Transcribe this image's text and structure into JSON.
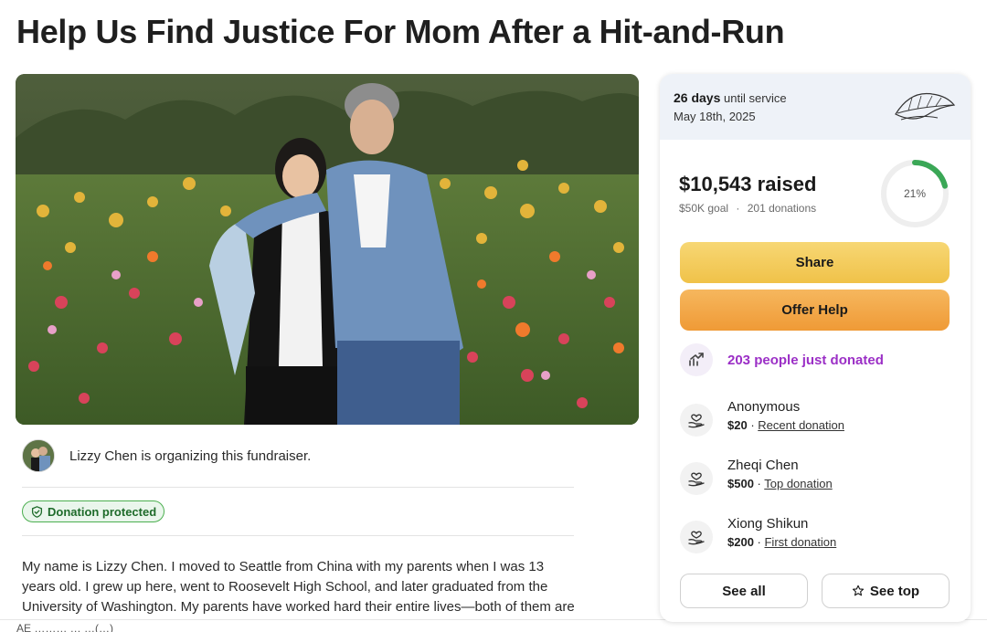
{
  "page": {
    "title": "Help Us Find Justice For Mom After a Hit-and-Run"
  },
  "organizer": {
    "text": "Lizzy Chen is organizing this fundraiser."
  },
  "badge": {
    "label": "Donation protected",
    "icon": "shield-check-icon"
  },
  "story": {
    "text": "My name is Lizzy Chen. I moved to Seattle from China with my parents when I was 13 years old. I grew up here, went to Roosevelt High School, and later graduated from the University of Washington. My parents have worked hard their entire lives—both of them are"
  },
  "footer": {
    "text": "AE  ……… … …(…)"
  },
  "service": {
    "days_count": "26 days",
    "days_suffix": "until service",
    "date": "May 18th, 2025",
    "icon": "leaf-icon"
  },
  "progress": {
    "raised": "$10,543 raised",
    "goal": "$50K goal",
    "separator": "·",
    "donations": "201 donations",
    "percent_label": "21%",
    "percent_value": 21,
    "ring_color": "#3aa756"
  },
  "actions": {
    "share": "Share",
    "offer_help": "Offer Help"
  },
  "trending": {
    "text": "203 people just donated",
    "icon": "trending-up-icon",
    "color": "#9b2fc6"
  },
  "donors": [
    {
      "name": "Anonymous",
      "amount": "$20",
      "sep": " · ",
      "tag": "Recent donation"
    },
    {
      "name": "Zheqi Chen",
      "amount": "$500",
      "sep": " · ",
      "tag": "Top donation"
    },
    {
      "name": "Xiong Shikun",
      "amount": "$200",
      "sep": " · ",
      "tag": "First donation"
    }
  ],
  "list_buttons": {
    "see_all": "See all",
    "see_top": "See top"
  }
}
